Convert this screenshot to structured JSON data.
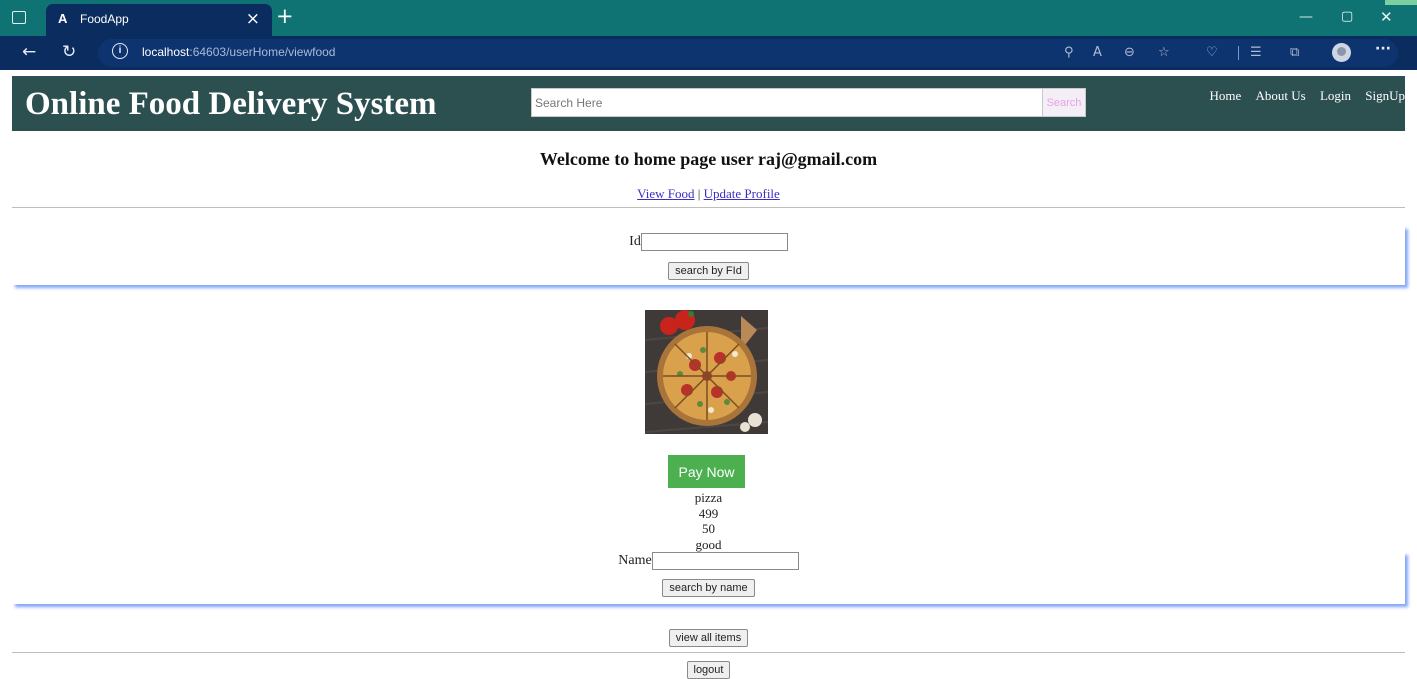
{
  "browser": {
    "tab_title": "FoodApp",
    "tab_favicon": "A",
    "url_host": "localhost",
    "url_path": ":64603/userHome/viewfood",
    "icons": [
      "window-icon",
      "close-icon",
      "plus-icon",
      "back-arrow-icon",
      "reload-icon",
      "info-icon",
      "key-icon",
      "read-aloud-icon",
      "zoom-icon",
      "favorite-add-icon",
      "browser-essentials-icon",
      "favorites-icon",
      "collections-icon",
      "profile-icon",
      "more-icon"
    ]
  },
  "header": {
    "title": "Online Food Delivery System",
    "search_placeholder": "Search Here",
    "search_button": "Search",
    "nav": [
      "Home",
      "About Us",
      "Login",
      "SignUp"
    ]
  },
  "welcome": "Welcome to home page user raj@gmail.com",
  "links": {
    "view_food": "View Food",
    "separator": "|",
    "update_profile": "Update Profile"
  },
  "id_search": {
    "label": "Id",
    "value": "",
    "button": "search by FId"
  },
  "food": {
    "image": "pizza-image",
    "pay_button": "Pay Now",
    "name": "pizza",
    "price": "499",
    "quantity": "50",
    "description": "good"
  },
  "name_search": {
    "label": "Name",
    "value": "",
    "button": "search by name"
  },
  "view_all_button": "view all items",
  "logout_button": "logout",
  "colors": {
    "tabbar": "#0f7373",
    "addressbar": "#0b2c5e",
    "header": "#2c4f50",
    "pay": "#4caf50",
    "panel_shadow": "#84a6f5"
  }
}
